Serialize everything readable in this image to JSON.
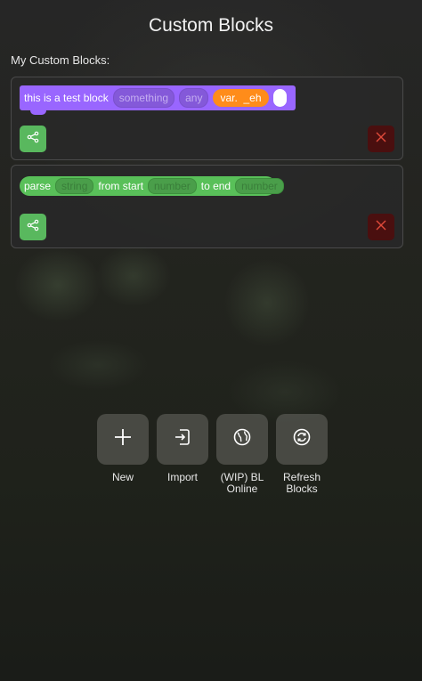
{
  "header": {
    "title": "Custom Blocks"
  },
  "section": {
    "label": "My Custom Blocks:"
  },
  "blocks": [
    {
      "color": "#9966ff",
      "label": "this is a test block",
      "inputs": [
        "something",
        "any",
        "var.",
        "_eh"
      ]
    },
    {
      "color": "#59c059",
      "parts": [
        "parse",
        "string",
        "from start",
        "number",
        "to end",
        "number"
      ]
    }
  ],
  "actions": [
    {
      "label": "New",
      "icon": "plus-icon"
    },
    {
      "label": "Import",
      "icon": "import-icon"
    },
    {
      "label": "(WIP) BL Online",
      "icon": "globe-icon"
    },
    {
      "label": "Refresh Blocks",
      "icon": "refresh-icon"
    }
  ],
  "colors": {
    "share": "#59b85e",
    "delete_bg": "#4a0f0f",
    "delete_icon": "#e04a3a"
  }
}
